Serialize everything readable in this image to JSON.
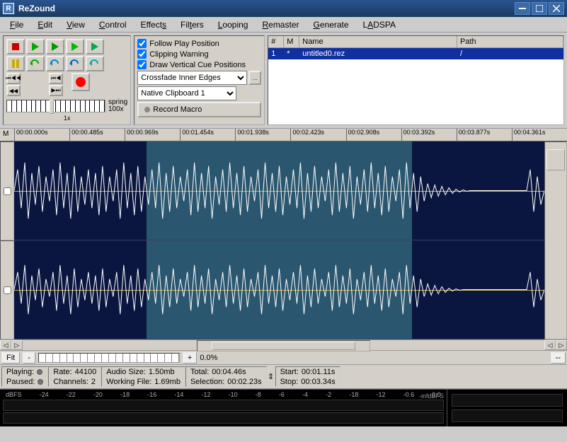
{
  "window": {
    "title": "ReZound"
  },
  "menu": [
    "File",
    "Edit",
    "View",
    "Control",
    "Effects",
    "Filters",
    "Looping",
    "Remaster",
    "Generate",
    "LADSPA"
  ],
  "options": {
    "follow_play": {
      "label": "Follow Play Position",
      "checked": true
    },
    "clip_warn": {
      "label": "Clipping Warning",
      "checked": true
    },
    "draw_cue": {
      "label": "Draw Vertical Cue Positions",
      "checked": true
    },
    "crossfade": {
      "value": "Crossfade Inner Edges"
    },
    "clipboard": {
      "value": "Native Clipboard 1"
    },
    "macro_btn": "Record Macro"
  },
  "spring": {
    "label": "spring",
    "value": "100x",
    "sub": "1x"
  },
  "filelist": {
    "headers": [
      "#",
      "M",
      "Name",
      "Path"
    ],
    "rows": [
      {
        "num": "1",
        "m": "*",
        "name": "untitled0.rez",
        "path": "/"
      }
    ]
  },
  "ruler": {
    "m": "M",
    "ticks": [
      "00:00.000s",
      "00:00.485s",
      "00:00.969s",
      "00:01.454s",
      "00:01.938s",
      "00:02.423s",
      "00:02.908s",
      "00:03.392s",
      "00:03.877s",
      "00:04.361s"
    ]
  },
  "zoom": {
    "fit": "Fit",
    "minus": "-",
    "plus": "+",
    "pct": "0.0%"
  },
  "status": {
    "playing": "Playing:",
    "paused": "Paused:",
    "rate_l": "Rate:",
    "rate_v": "44100",
    "channels_l": "Channels:",
    "channels_v": "2",
    "audio_l": "Audio Size:",
    "audio_v": "1.50mb",
    "work_l": "Working File:",
    "work_v": "1.69mb",
    "total_l": "Total:",
    "total_v": "00:04.46s",
    "sel_l": "Selection:",
    "sel_v": "00:02.23s",
    "start_l": "Start:",
    "start_v": "00:01.11s",
    "stop_l": "Stop:",
    "stop_v": "00:03.34s"
  },
  "meter": {
    "scale": [
      "dBFS",
      "-24",
      "-22",
      "-20",
      "-18",
      "-16",
      "-14",
      "-12",
      "-10",
      "-8",
      "-6",
      "-4",
      "-2",
      "-18",
      "-12",
      "-0.6",
      "0.0"
    ],
    "readout": "-infdBFS"
  }
}
